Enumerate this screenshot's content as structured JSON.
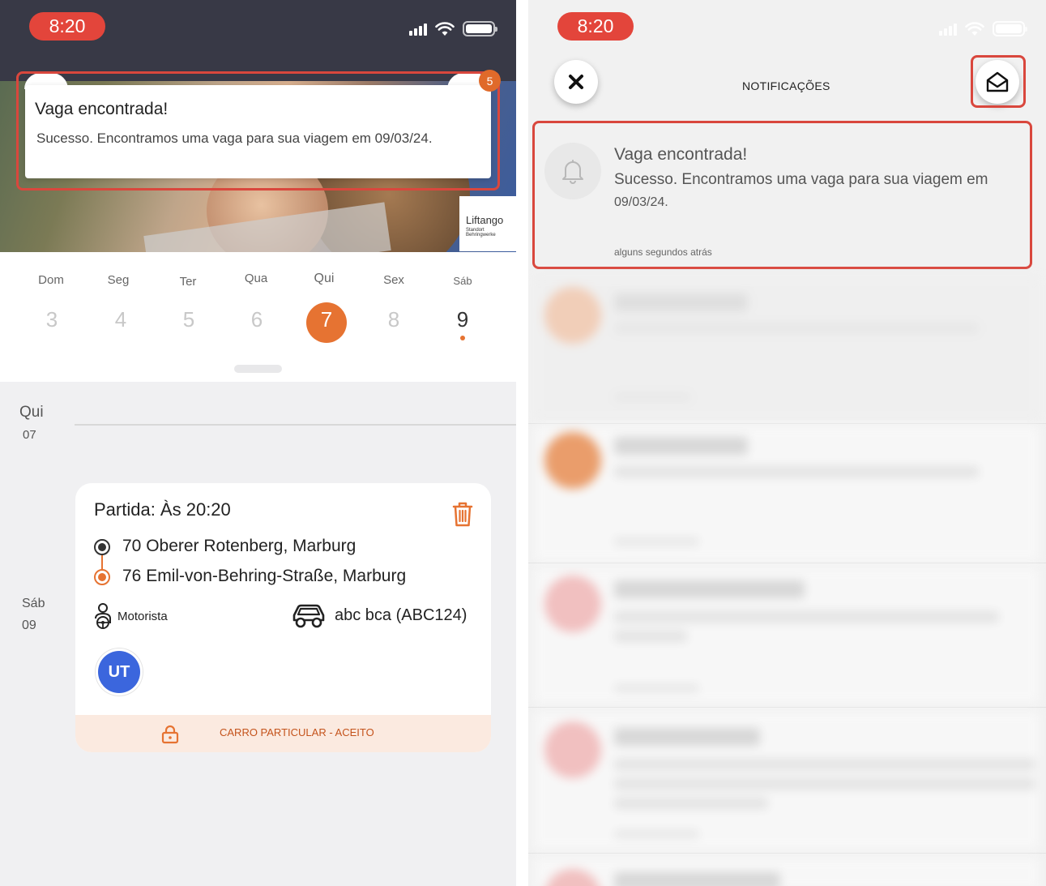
{
  "status": {
    "time_left": "8:20",
    "time_right": "8:20"
  },
  "toast": {
    "badge": "5",
    "title": "Vaga encontrada!",
    "body": "Sucesso. Encontramos uma vaga para sua viagem em 09/03/24."
  },
  "brand": {
    "name": "Liftango",
    "sub": "Standort Behringwerke"
  },
  "calendar": {
    "days": [
      {
        "name": "Dom",
        "num": "3"
      },
      {
        "name": "Seg",
        "num": "4"
      },
      {
        "name": "Ter",
        "num": "5"
      },
      {
        "name": "Qua",
        "num": "6"
      },
      {
        "name": "Qui",
        "num": "7"
      },
      {
        "name": "Sex",
        "num": "8"
      },
      {
        "name": "Sáb",
        "num": "9"
      }
    ],
    "selected_day": "7"
  },
  "agenda": {
    "day1_name": "Qui",
    "day1_num": "07",
    "day2_name": "Sáb",
    "day2_num": "09"
  },
  "trip": {
    "title": "Partida: Às 20:20",
    "origin": "70 Oberer Rotenberg, Marburg",
    "destination": "76 Emil-von-Behring-Straße, Marburg",
    "role": "Motorista",
    "vehicle": "abc bca (ABC124)",
    "avatar": "UT",
    "status": "CARRO PARTICULAR - ACEITO"
  },
  "notifications": {
    "header_title": "NOTIFICAÇÕES",
    "items": [
      {
        "title": "Vaga encontrada!",
        "body_line1": "Sucesso. Encontramos uma vaga para sua viagem em",
        "body_line2": "09/03/24.",
        "time": "alguns segundos atrás"
      }
    ]
  },
  "colors": {
    "accent": "#e67332",
    "highlight": "#d9473d",
    "status_pill": "#e3453b",
    "avatar": "#3b66dd"
  }
}
